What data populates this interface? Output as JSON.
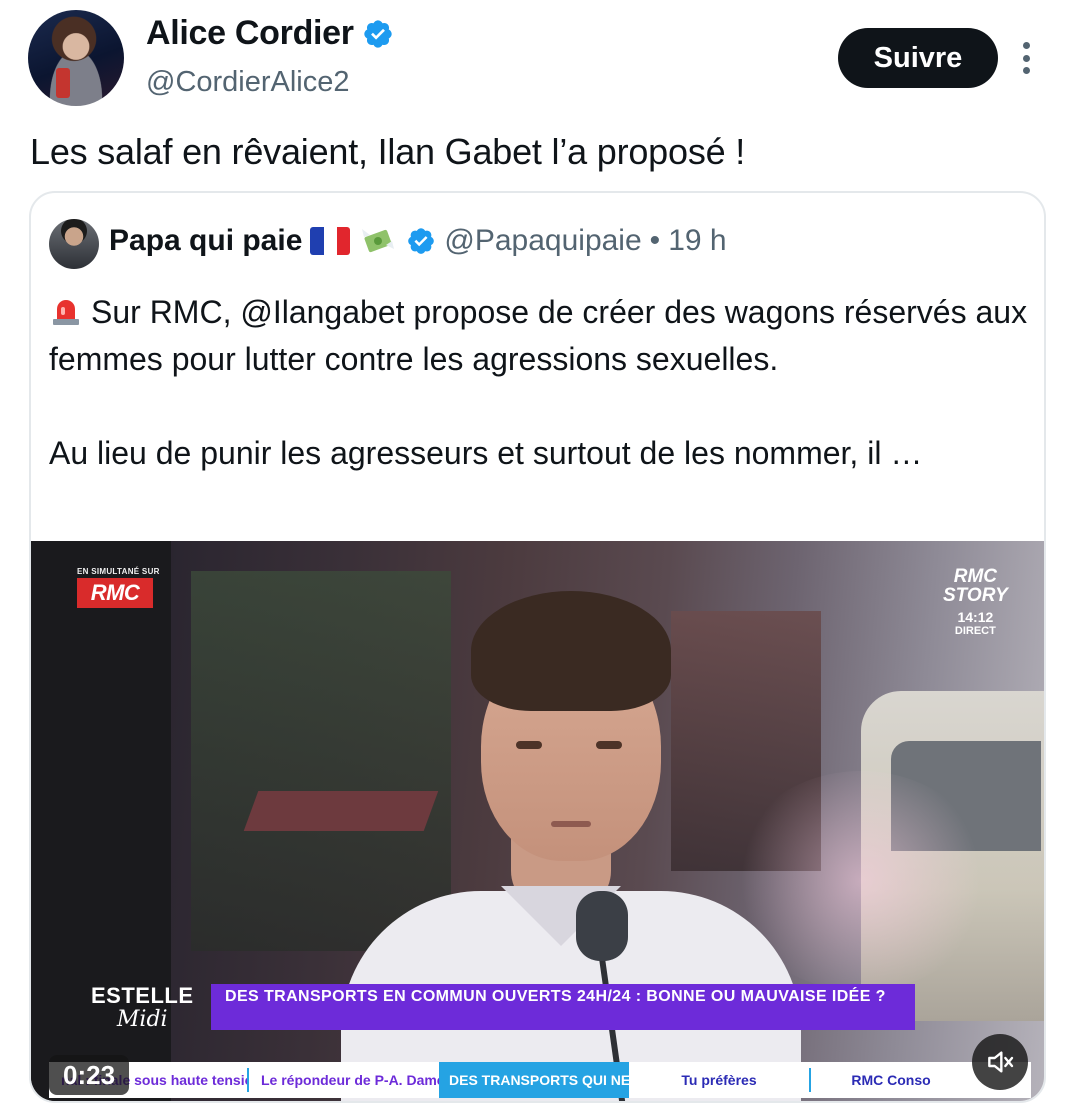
{
  "author": {
    "display_name": "Alice Cordier",
    "handle": "@CordierAlice2",
    "verified": true
  },
  "actions": {
    "follow_label": "Suivre",
    "more_icon": "more-vertical-icon"
  },
  "tweet": {
    "text": "Les salaf en rêvaient, Ilan Gabet l’a proposé !"
  },
  "quoted": {
    "display_name": "Papa qui paie",
    "handle": "@Papaquipaie",
    "separator": "•",
    "time": "19 h",
    "verified": true,
    "emoji_icons": [
      "french-flag-icon",
      "money-with-wings-icon"
    ],
    "text_line1": "Sur RMC, @Ilangabet propose de créer des wagons réservés aux femmes pour lutter contre les agressions sexuelles.",
    "text_line2": "Au lieu de punir les agresseurs et surtout de les nommer, il …",
    "lead_icon": "rotating-light-icon"
  },
  "video": {
    "duration": "0:23",
    "rmc_simulcast": "EN SIMULTANÉ SUR",
    "rmc_logo": "RMC",
    "story_line1": "RMC",
    "story_line2": "STORY",
    "story_time": "14:12",
    "story_live": "DIRECT",
    "show_line1": "ESTELLE",
    "show_line2": "Midi",
    "headline": "DES TRANSPORTS EN COMMUN OUVERTS 24H/24 : BONNE OU MAUVAISE IDÉE ?",
    "ticker": [
      "nal : finale sous haute tension ?",
      "Le répondeur de P-A. Damecour",
      "DES TRANSPORTS QUI NE DORMENT JAMAIS ?",
      "Tu préfères",
      "RMC Conso"
    ],
    "mute_icon": "volume-muted-icon"
  },
  "colors": {
    "text": "#0f1419",
    "muted": "#536471",
    "verified_blue": "#1d9bf0",
    "follow_bg": "#0f1419",
    "headline_purple": "#6d2bd9",
    "ticker_blue": "#25a3e3",
    "rmc_red": "#d92b2b"
  }
}
